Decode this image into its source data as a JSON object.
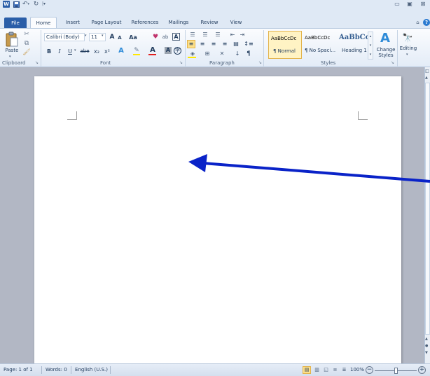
{
  "window": {
    "app_icon": "W",
    "controls": {
      "minimize": "▭",
      "restore": "▣",
      "close": "⊠"
    },
    "help_icon": "?"
  },
  "qat": {
    "save_icon": "save-icon",
    "undo_icon": "undo-icon",
    "redo_icon": "redo-icon",
    "customize": "customize-icon"
  },
  "tabs": [
    {
      "label": "File",
      "active_file": true
    },
    {
      "label": "Home",
      "active": true
    },
    {
      "label": "Insert"
    },
    {
      "label": "Page Layout"
    },
    {
      "label": "References"
    },
    {
      "label": "Mailings"
    },
    {
      "label": "Review"
    },
    {
      "label": "View"
    }
  ],
  "clipboard": {
    "paste_label": "Paste",
    "group_label": "Clipboard"
  },
  "font": {
    "name": "Calibri (Body)",
    "size": "11",
    "bold": "B",
    "italic": "I",
    "underline": "U",
    "strike": "abe",
    "subscript": "x₂",
    "superscript": "x²",
    "grow": "A",
    "shrink": "A",
    "change_case": "Aa",
    "group_label": "Font"
  },
  "paragraph": {
    "group_label": "Paragraph",
    "pilcrow": "¶"
  },
  "styles": {
    "group_label": "Styles",
    "items": [
      {
        "preview": "AaBbCcDc",
        "name": "¶ Normal"
      },
      {
        "preview": "AaBbCcDc",
        "name": "¶ No Spaci..."
      },
      {
        "preview": "AaBbCc",
        "name": "Heading 1"
      }
    ],
    "change_styles_label": "Change Styles"
  },
  "editing": {
    "label": "Editing"
  },
  "status": {
    "page": "Page: 1 of 1",
    "words": "Words: 0",
    "language": "English (U.S.)",
    "zoom": "100%"
  },
  "colors": {
    "file_tab": "#2a5ea8",
    "arrow": "#0a23c8",
    "doc_bg": "#b2b7c4"
  }
}
